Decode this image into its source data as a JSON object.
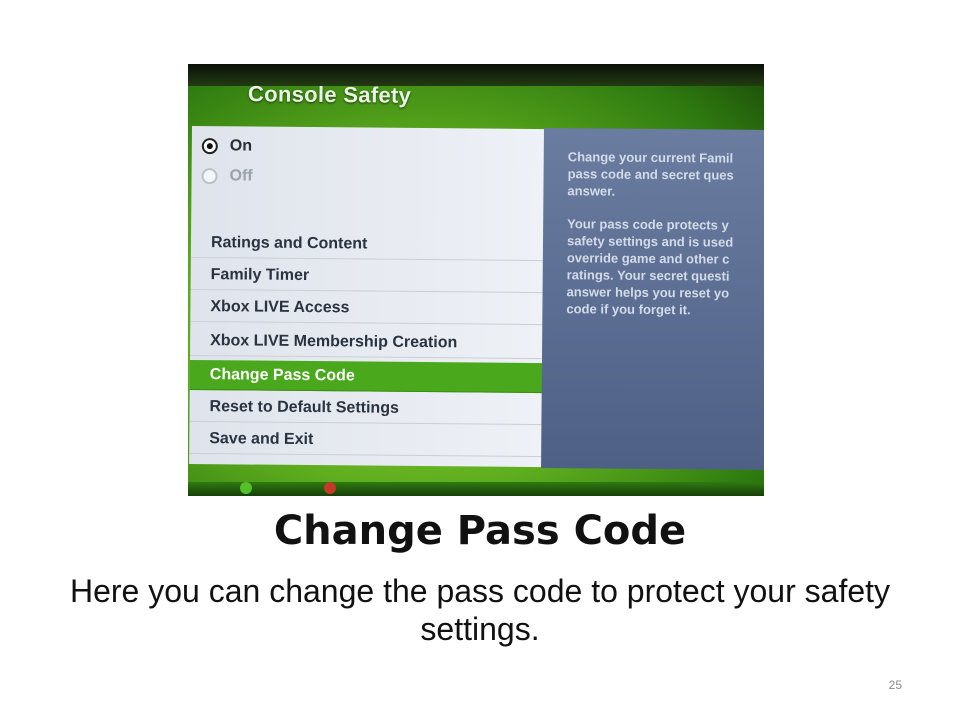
{
  "photo": {
    "screen_title": "Console Safety",
    "radios": [
      {
        "label": "On",
        "selected": true
      },
      {
        "label": "Off",
        "selected": false
      }
    ],
    "menu_items": [
      {
        "label": "Ratings and Content"
      },
      {
        "label": "Family Timer"
      },
      {
        "label": "Xbox LIVE Access"
      },
      {
        "label": "Xbox LIVE Membership Creation"
      },
      {
        "label": "Change Pass Code",
        "selected": true
      },
      {
        "label": "Reset to Default Settings"
      },
      {
        "label": "Save and Exit"
      }
    ],
    "info_text_1": "Change your current Famil\npass code and secret ques\nanswer.",
    "info_text_2": "Your pass code protects y\nsafety settings and is used\noverride game and other c\nratings. Your secret questi\nanswer helps you reset yo\ncode if you forget it."
  },
  "slide": {
    "title": "Change Pass Code",
    "body": "Here you can change the pass code to protect your safety settings.",
    "page_number": "25"
  },
  "colors": {
    "accent_green": "#4aa81c",
    "info_panel": "#5a6c92"
  }
}
